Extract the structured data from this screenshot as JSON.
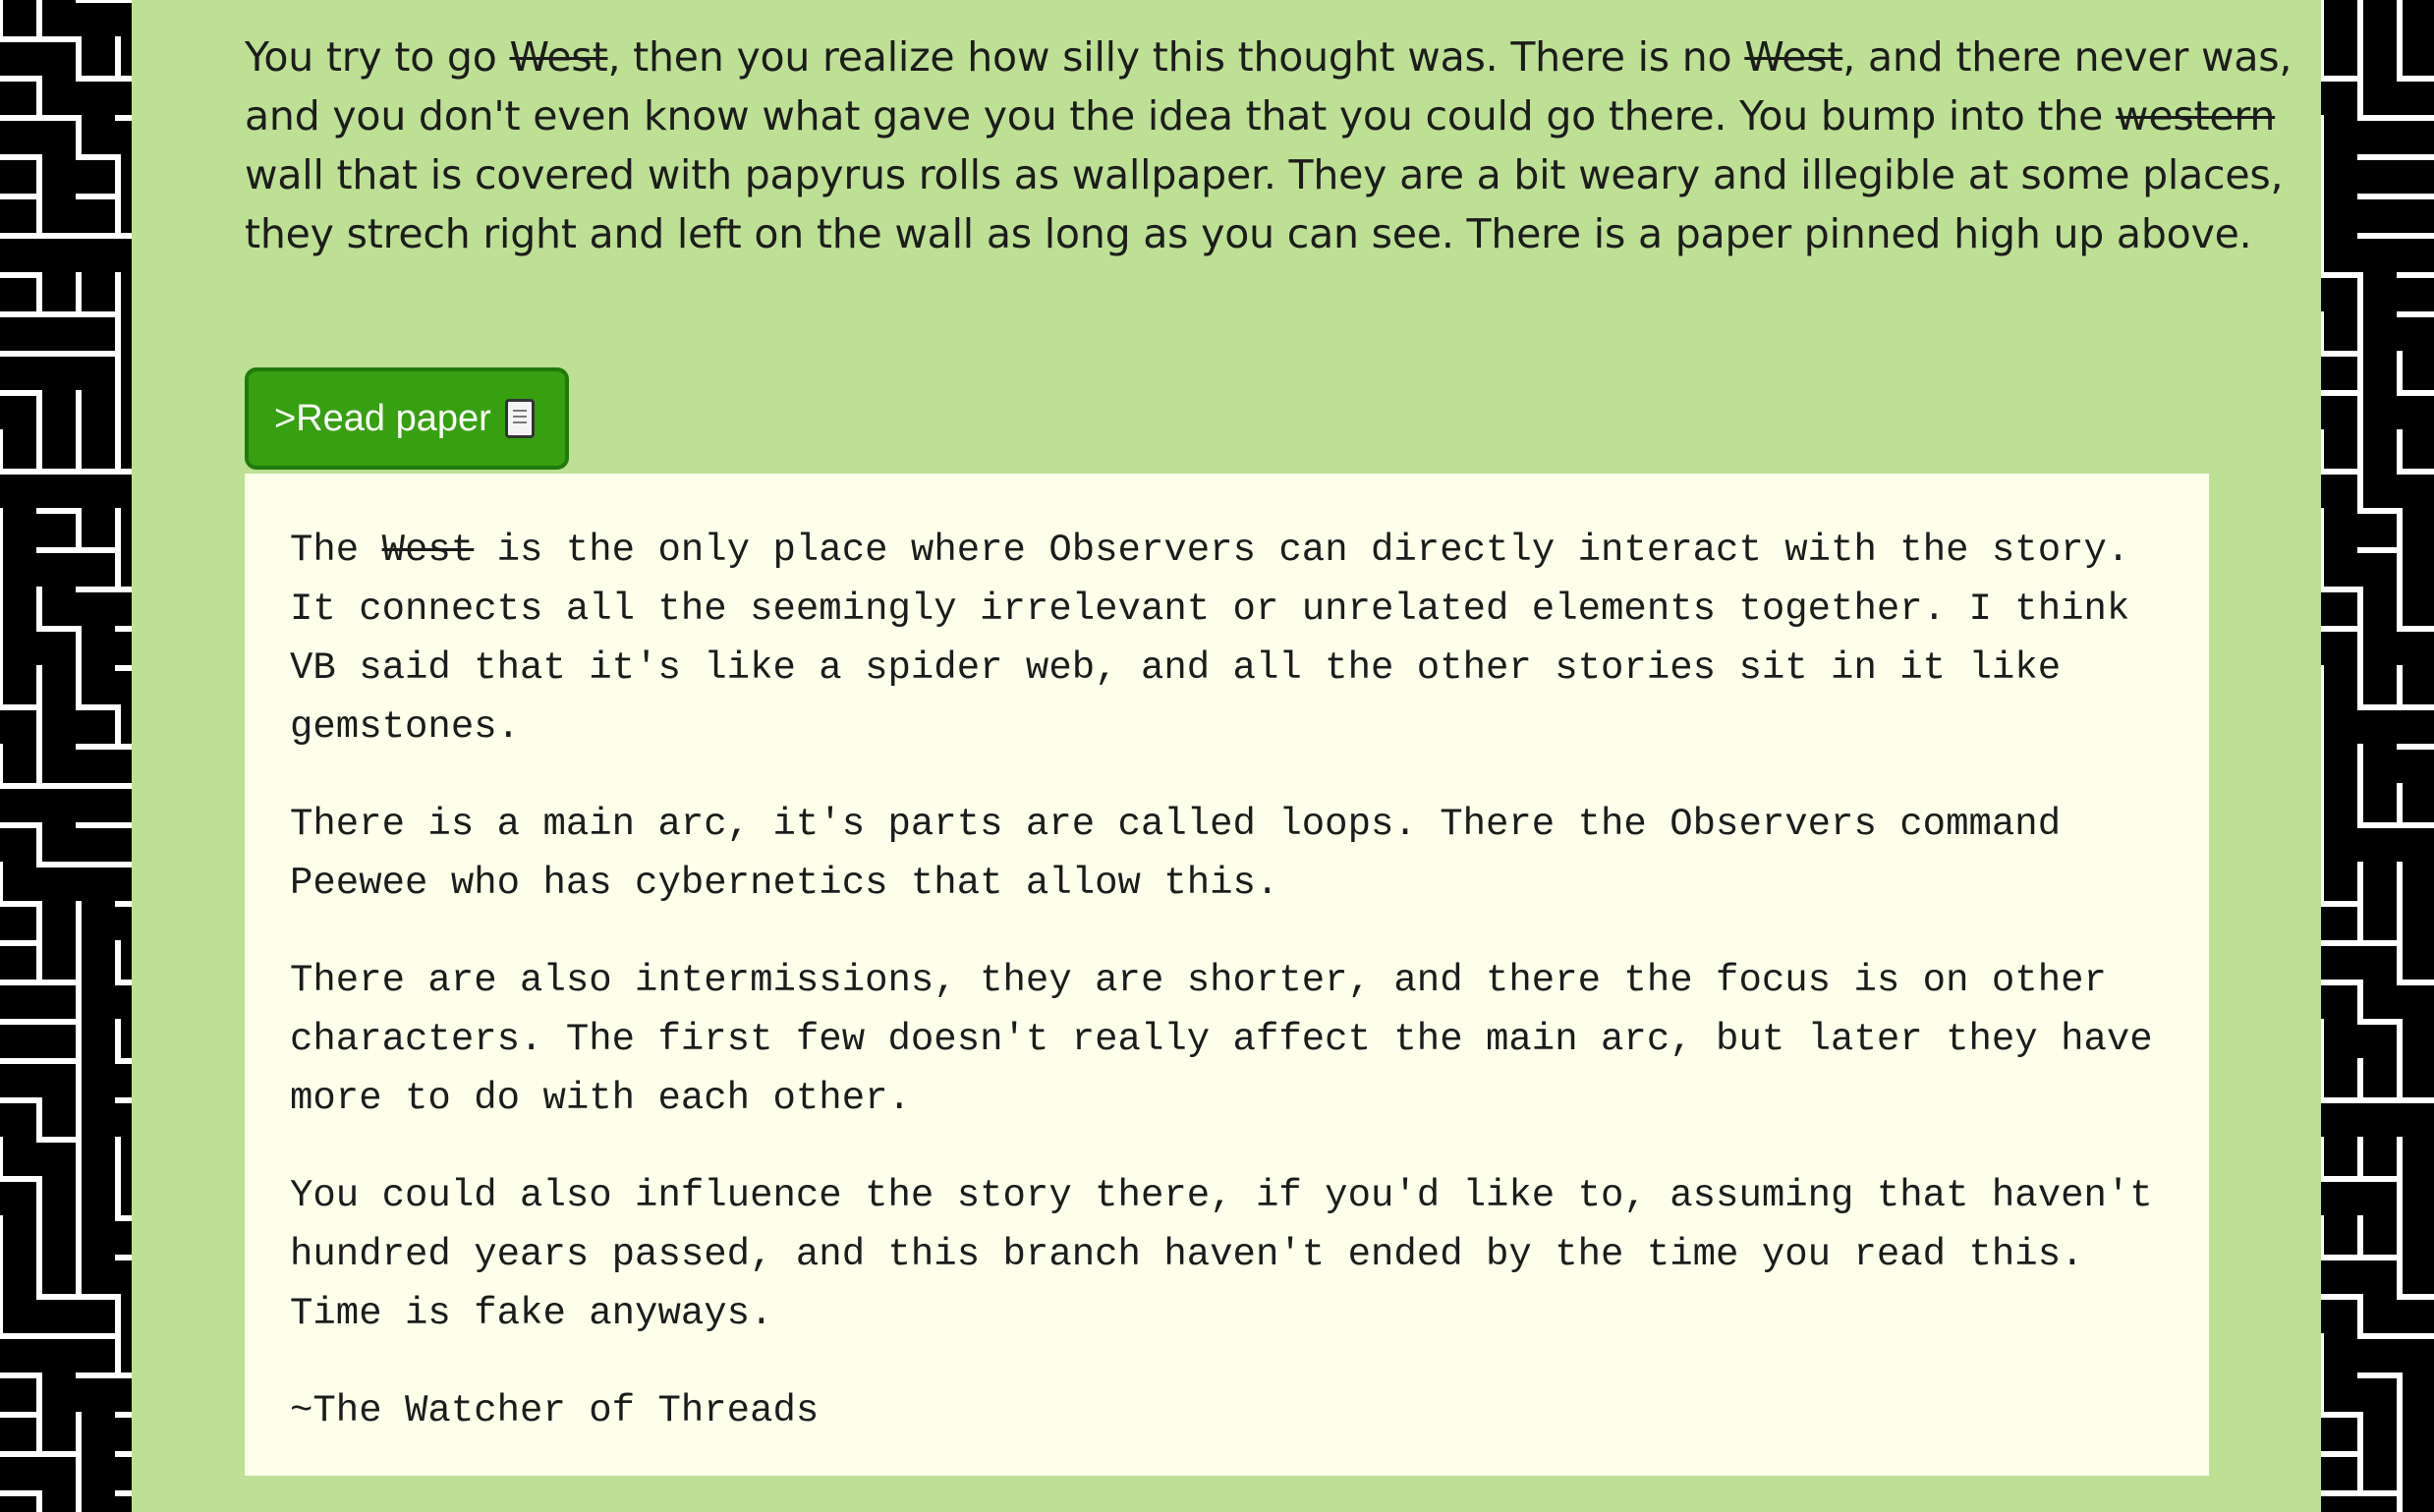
{
  "story": {
    "part1": "You try to go ",
    "struck1": "West",
    "part2": ", then you realize how silly this thought was. There is no ",
    "struck2": "West",
    "part3": ", and there never was, and you don't even know what gave you the idea that you could go there. You bump into the ",
    "struck3": "western",
    "part4": " wall that is covered with papyrus rolls as wallpaper. They are a bit weary and illegible at some places, they strech right and left on the wall as long as you can see. There is a paper pinned high up above."
  },
  "action": {
    "label": ">Read paper",
    "icon": "scroll-icon",
    "color": "#36a010"
  },
  "paper": {
    "p1_before": "The ",
    "p1_struck": "West",
    "p1_after": " is the only place where Observers can directly interact with the story. It connects all the seemingly irrelevant or unrelated elements together. I think VB said that it's like a spider web, and all the other stories sit in it like gemstones.",
    "p2": "There is a main arc, it's parts are called loops. There the Observers command Peewee who has cybernetics that allow this.",
    "p3": "There are also intermissions, they are shorter, and there the focus is on other characters. The first few doesn't really affect the main arc, but later they have more to do with each other.",
    "p4": "You could also influence the story there, if you'd like to, assuming that haven't hundred years passed, and this branch haven't ended by the time you read this. Time is fake anyways.",
    "signature": "~The Watcher of Threads"
  },
  "colors": {
    "panel": "#bde095",
    "paper": "#fdffeb",
    "maze_wall": "#ffffff",
    "maze_bg": "#000000"
  }
}
